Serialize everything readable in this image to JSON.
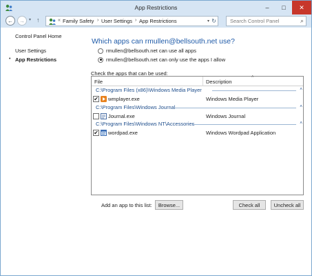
{
  "window": {
    "title": "App Restrictions",
    "minimize_glyph": "–",
    "maximize_glyph": "□",
    "close_glyph": "✕"
  },
  "address_bar": {
    "back_glyph": "←",
    "forward_glyph": "→",
    "dropdown_glyph": "▾",
    "up_glyph": "↑",
    "overflow": "«",
    "breadcrumb": [
      "Family Safety",
      "User Settings",
      "App Restrictions"
    ],
    "separator": "›",
    "refresh_glyph": "↻",
    "search_placeholder": "Search Control Panel",
    "search_glyph": "⌕"
  },
  "sidebar": {
    "items": [
      {
        "label": "Control Panel Home"
      },
      {
        "label": "User Settings"
      },
      {
        "label": "App Restrictions"
      }
    ],
    "bullet": "•"
  },
  "main": {
    "heading": "Which apps can rmullen@bellsouth.net use?",
    "options": [
      {
        "label": "rmullen@bellsouth.net can use all apps",
        "selected": false
      },
      {
        "label": "rmullen@bellsouth.net can only use the apps I allow",
        "selected": true
      }
    ],
    "check_label": "Check the apps that can be used:",
    "columns": {
      "file": "File",
      "description": "Description"
    },
    "sort_glyph": "˄",
    "collapse_glyph": "˄",
    "groups": [
      {
        "path": "C:\\Program Files (x86)\\Windows Media Player",
        "items": [
          {
            "file": "wmplayer.exe",
            "description": "Windows Media Player",
            "checked": true,
            "check_glyph": "✔"
          }
        ]
      },
      {
        "path": "C:\\Program Files\\Windows Journal",
        "items": [
          {
            "file": "Journal.exe",
            "description": "Windows Journal",
            "checked": false,
            "check_glyph": ""
          }
        ]
      },
      {
        "path": "C:\\Program Files\\Windows NT\\Accessories",
        "items": [
          {
            "file": "wordpad.exe",
            "description": "Windows Wordpad Application",
            "checked": true,
            "check_glyph": "✔"
          }
        ]
      }
    ],
    "add_label": "Add an app to this list:",
    "browse_label": "Browse...",
    "check_all_label": "Check all",
    "uncheck_all_label": "Uncheck all"
  },
  "colors": {
    "heading": "#1e5aa8",
    "group_text": "#1e4e8c",
    "titlebar": "#d6e5f4",
    "close_button": "#c7372b"
  }
}
